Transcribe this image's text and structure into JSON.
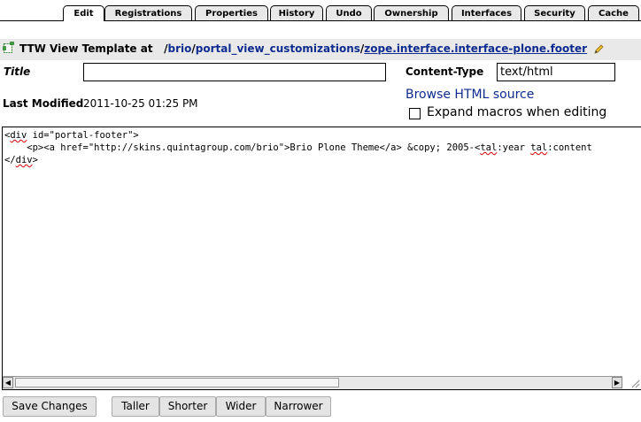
{
  "tabs": [
    {
      "label": "Edit",
      "active": true
    },
    {
      "label": "Registrations"
    },
    {
      "label": "Properties"
    },
    {
      "label": "History"
    },
    {
      "label": "Undo"
    },
    {
      "label": "Ownership"
    },
    {
      "label": "Interfaces"
    },
    {
      "label": "Security"
    },
    {
      "label": "Cache"
    }
  ],
  "header": {
    "prefix": "TTW View Template at",
    "path": [
      {
        "sep": "/",
        "segment": "brio"
      },
      {
        "sep": "/",
        "segment": "portal_view_customizations"
      },
      {
        "sep": "/",
        "segment": "zope.interface.interface-plone.footer"
      }
    ],
    "icons": {
      "template": "template-icon",
      "edit": "pencil-icon"
    }
  },
  "form": {
    "title_label": "Title",
    "title_value": "",
    "content_type_label": "Content-Type",
    "content_type_value": "text/html",
    "last_modified_label": "Last Modified",
    "last_modified_value": "2011-10-25 01:25 PM",
    "browse_link": "Browse HTML source",
    "expand_macros_label": "Expand macros when editing",
    "expand_macros_checked": false
  },
  "editor": {
    "lines": [
      "<div id=\"portal-footer\">",
      "    <p><a href=\"http://skins.quintagroup.com/brio\">Brio Plone Theme</a> &copy; 2005-<tal:year tal:content",
      "</div>"
    ],
    "scroll_icons": {
      "left": "scroll-left-arrow",
      "right": "scroll-right-arrow"
    }
  },
  "buttons": {
    "save": "Save Changes",
    "taller": "Taller",
    "shorter": "Shorter",
    "wider": "Wider",
    "narrower": "Narrower"
  },
  "colors": {
    "link": "#0f2c8f",
    "tab_bg": "#e8e8e8",
    "header_bg": "#e9e9e9",
    "squiggle": "#d40000"
  }
}
